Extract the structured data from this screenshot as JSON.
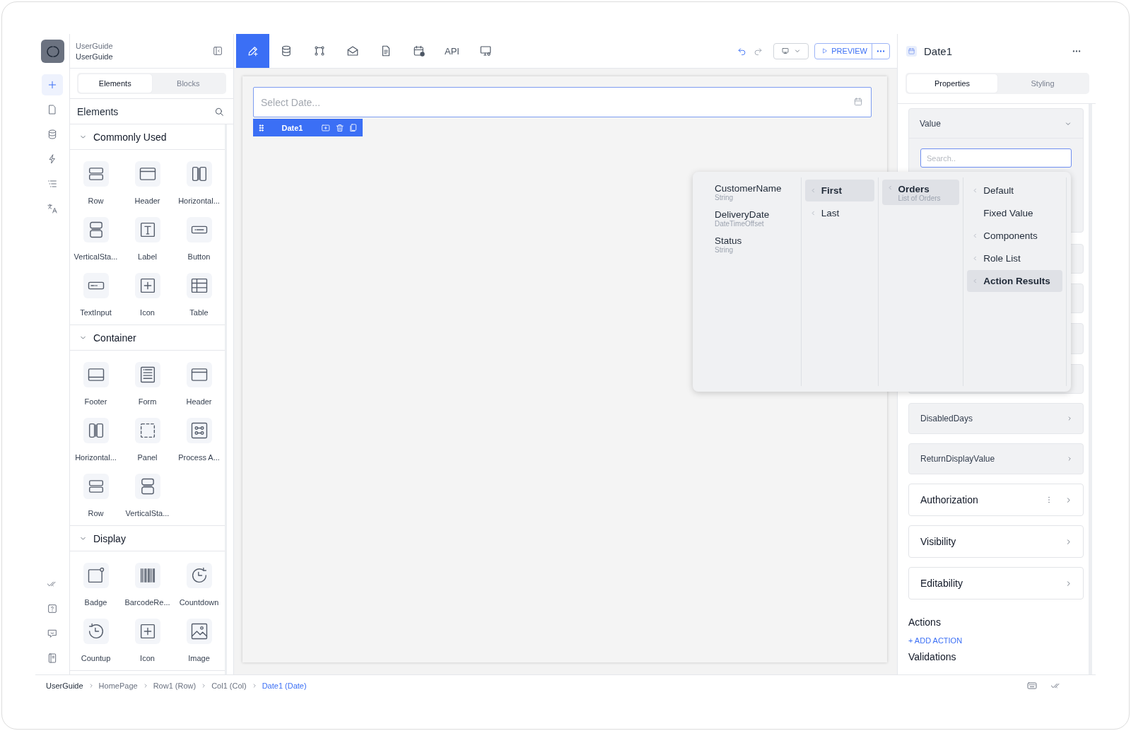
{
  "workspace": {
    "caption": "UserGuide",
    "name": "UserGuide"
  },
  "rail_items": [
    {
      "selected": true
    },
    {
      "selected": false
    },
    {
      "selected": false
    },
    {
      "selected": false
    },
    {
      "selected": false
    },
    {
      "selected": false
    }
  ],
  "sidebar": {
    "tabs": [
      {
        "label": "Elements",
        "selected": true
      },
      {
        "label": "Blocks",
        "selected": false
      }
    ],
    "title": "Elements",
    "sections": [
      {
        "title": "Commonly Used",
        "expanded": true,
        "items": [
          "Row",
          "Header",
          "Horizontal...",
          "VerticalSta...",
          "Label",
          "Button",
          "TextInput",
          "Icon",
          "Table"
        ]
      },
      {
        "title": "Container",
        "expanded": true,
        "items": [
          "Footer",
          "Form",
          "Header",
          "Horizontal...",
          "Panel",
          "Process A...",
          "Row",
          "VerticalSta..."
        ]
      },
      {
        "title": "Display",
        "expanded": true,
        "items": [
          "Badge",
          "BarcodeRe...",
          "Countdown",
          "Countup",
          "Icon",
          "Image"
        ]
      }
    ]
  },
  "toolbar": {
    "tools": [
      {
        "kind": "icon",
        "selected": true
      },
      {
        "kind": "icon",
        "selected": false
      },
      {
        "kind": "icon",
        "selected": false
      },
      {
        "kind": "icon",
        "selected": false
      },
      {
        "kind": "icon",
        "selected": false
      },
      {
        "kind": "icon",
        "selected": false
      },
      {
        "kind": "text",
        "label": "API",
        "selected": false
      },
      {
        "kind": "icon",
        "selected": false
      }
    ],
    "preview": "PREVIEW"
  },
  "canvas": {
    "date_placeholder": "Select Date...",
    "component_label": "Date1"
  },
  "picker": {
    "fields": [
      {
        "name": "CustomerName",
        "type": "String"
      },
      {
        "name": "DeliveryDate",
        "type": "DateTimeOffset"
      },
      {
        "name": "Status",
        "type": "String"
      }
    ],
    "items": [
      {
        "label": "First",
        "selected": true
      },
      {
        "label": "Last",
        "selected": false
      }
    ],
    "lists": [
      {
        "label": "Orders",
        "sublabel": "List of Orders",
        "selected": true
      }
    ],
    "sources": [
      {
        "label": "Default",
        "selected": false,
        "submenu": true
      },
      {
        "label": "Fixed Value",
        "selected": false,
        "submenu": false
      },
      {
        "label": "Components",
        "selected": false,
        "submenu": true
      },
      {
        "label": "Role List",
        "selected": false,
        "submenu": true
      },
      {
        "label": "Action Results",
        "selected": true,
        "submenu": true
      }
    ]
  },
  "properties": {
    "title": "Date1",
    "tabs": [
      {
        "label": "Properties",
        "selected": true
      },
      {
        "label": "Styling",
        "selected": false
      }
    ],
    "value_section": {
      "title": "Value",
      "expanded": true,
      "search_placeholder": "Search.."
    },
    "groups": [
      {
        "label": "DisabledDays",
        "kind": "nested",
        "menu": false
      },
      {
        "label": "ReturnDisplayValue",
        "kind": "nested",
        "menu": false
      },
      {
        "label": "Authorization",
        "kind": "section",
        "menu": true
      },
      {
        "label": "Visibility",
        "kind": "section",
        "menu": false
      },
      {
        "label": "Editability",
        "kind": "section",
        "menu": false
      }
    ],
    "actions_title": "Actions",
    "add_action": "+ ADD ACTION",
    "validations_title": "Validations"
  },
  "breadcrumb": [
    {
      "label": "UserGuide",
      "current": false
    },
    {
      "label": "HomePage",
      "current": false
    },
    {
      "label": "Row1 (Row)",
      "current": false
    },
    {
      "label": "Col1 (Col)",
      "current": false
    },
    {
      "label": "Date1 (Date)",
      "current": true
    }
  ]
}
